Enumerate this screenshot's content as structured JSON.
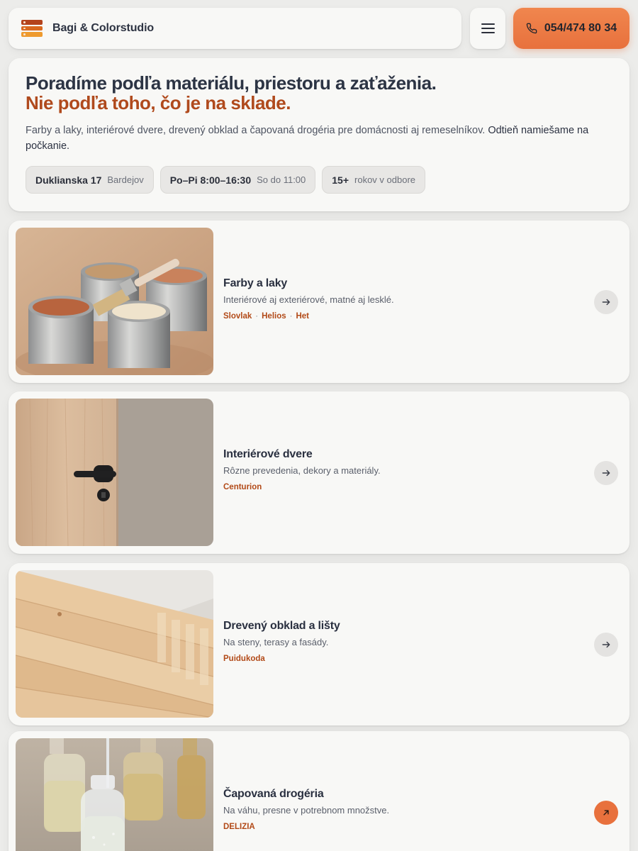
{
  "header": {
    "brand": "Bagi & Colorstudio",
    "phone": "054/474 80 34"
  },
  "hero": {
    "title": "Poradíme podľa materiálu, priestoru a zaťaženia.",
    "title_accent": "Nie podľa toho, čo je na sklade.",
    "description": "Farby a laky, interiérové dvere, drevený obklad a čapovaná drogéria pre domácnosti aj remeselníkov.",
    "description_strong": "Odtieň namiešame na počkanie.",
    "chips": [
      {
        "main": "Dukliansk​a 17",
        "sub": "Bardejov"
      },
      {
        "main": "Po–Pi 8:00–16:30",
        "sub": "So do 11:00"
      },
      {
        "main": "15+",
        "sub": "rokov v odbore"
      }
    ]
  },
  "categories": [
    {
      "title": "Farby a laky",
      "description": "Interiérové aj exteriérové, matné aj lesklé.",
      "tags": [
        "Slovlak",
        "Helios",
        "Het"
      ]
    },
    {
      "title": "Interiérové dvere",
      "description": "Rôzne prevedenia, dekory a materiály.",
      "tags": [
        "Centurion"
      ]
    },
    {
      "title": "Drevený obklad a lišty",
      "description": "Na steny, terasy a fasády.",
      "tags": [
        "Puidukoda"
      ]
    },
    {
      "title": "Čapovaná drogéria",
      "description": "Na váhu, presne v potrebnom množstve.",
      "tags": [
        "DELIZIA"
      ]
    }
  ],
  "icons": {
    "menu": "hamburger-menu-icon",
    "phone": "phone-icon",
    "arrow": "arrow-right-icon",
    "external": "arrow-up-right-icon"
  },
  "colors": {
    "accent": "#e8713d",
    "accent_text": "#b04a1d",
    "background": "#ececea",
    "card": "#f8f8f6"
  }
}
